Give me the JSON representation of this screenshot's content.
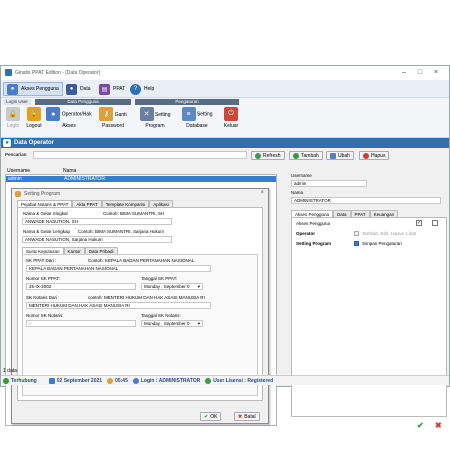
{
  "window": {
    "title": "Ginatis PPAT Edition - [Data Operator]"
  },
  "ribbon_top": {
    "akses": "Akses Pengguna",
    "data": "Data",
    "ppat": "PPAT",
    "help": "Help"
  },
  "ribbon": {
    "login_user": "Login User",
    "group_data_pengguna": "Data Pengguna",
    "group_pengaturan": "Pengaturan",
    "tools": {
      "login": "Login",
      "logout": "Logout",
      "operator": "Operator/Hak Akses",
      "ganti_password": "Ganti Password",
      "setting_program": "Setting Program",
      "setting_database": "Setting Database",
      "keluar": "Keluar"
    }
  },
  "header": {
    "title": "Data Operator"
  },
  "search": {
    "label": "Pencarian",
    "refresh": "Refresh",
    "tambah": "Tambah",
    "ubah": "Ubah",
    "hapus": "Hapus"
  },
  "grid": {
    "col_username": "Username",
    "col_nama": "Nama",
    "rows": [
      {
        "username": "admin",
        "nama": "ADMINISTRATOR"
      }
    ]
  },
  "dialog": {
    "title": "Setting Program",
    "tabs": [
      "Pejabat Notaris & PPAT",
      "Akta PPAT",
      "Template Komparisi",
      "Aplikasi"
    ],
    "nama_gelar_singkat_label": "Nama & Gelar Singkat",
    "nama_gelar_singkat_hint": "Contoh: BIMA SUMANTRI, SH",
    "nama_gelar_singkat_value": "ANWADE NASUTION, SH",
    "nama_gelar_lengkap_label": "Nama & Gelar Lengkap",
    "nama_gelar_lengkap_hint": "Contoh: BIMA SUMANTRI, Sarjana Hukum",
    "nama_gelar_lengkap_value": "ANWADE NASUTION, Sarjana Hukum",
    "subtabs": [
      "Surat Keputusan",
      "Kantor",
      "Data Pribadi"
    ],
    "sk_ppat_dari_label": "SK PPAT Dari :",
    "sk_ppat_dari_hint": "Contoh: KEPALA BADAN PERTANAHAN NASIONAL",
    "sk_ppat_dari_value": "KEPALA BADAN PERTANAHAN NASIONAL",
    "nomor_sk_ppat_label": "Nomor SK PPAT:",
    "nomor_sk_ppat_value": "25-IX-2002",
    "tanggal_sk_ppat_label": "Tanggal SK PPAT:",
    "tanggal_sk_ppat_value": "Monday , September 0",
    "sk_notaris_dari_label": "SK Notaris Dari :",
    "sk_notaris_dari_hint": "contoh: MENTERI HUKUM DAN HAK ASASI MANUSIA RI",
    "sk_notaris_dari_value": "MENTERI HUKUM DAN HAK ASASI MANUSIA RI",
    "nomor_sk_notaris_label": "Nomor SK Notaris:",
    "nomor_sk_notaris_value": "-",
    "tanggal_sk_notaris_label": "Tanggal SK Notaris:",
    "tanggal_sk_notaris_value": "Monday , September 0",
    "ok": "OK",
    "batal": "Batal"
  },
  "detail": {
    "username_label": "Username",
    "username_value": "admin",
    "nama_label": "Nama",
    "nama_value": "ADMINISTRATOR",
    "tabs": [
      "Akses Pengguna",
      "Data",
      "PPAT",
      "Keuangan"
    ],
    "akses_pengguna_label": "Akses Pengguna",
    "operator_label": "Operator",
    "operator_option": "Tambah, Edit, Hapus, Lihat",
    "setting_program_label": "Setting Program",
    "setting_option": "Simpan Pengaturan"
  },
  "status": {
    "count": "1 data",
    "connection": "Terhubung",
    "date": "02 September 2021",
    "time": "05:45",
    "login": "Login : ADMINISTRATOR",
    "license": "User Lisensi : Registered"
  },
  "colors": {
    "accent": "#2f6fb3",
    "selection": "#3b7bd4",
    "ok_green": "#2e9b3a",
    "delete_red": "#d23b2f"
  }
}
